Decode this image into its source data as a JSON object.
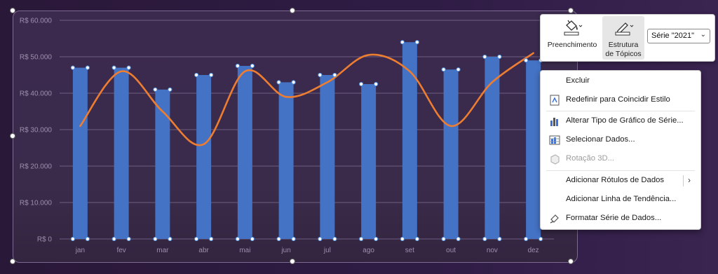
{
  "chart_data": {
    "type": "bar",
    "categories": [
      "jan",
      "fev",
      "mar",
      "abr",
      "mai",
      "jun",
      "jul",
      "ago",
      "set",
      "out",
      "nov",
      "dez"
    ],
    "series": [
      {
        "values": [
          47000,
          47000,
          41000,
          45000,
          47500,
          43000,
          45000,
          42500,
          54000,
          46500,
          50000,
          49000
        ],
        "color": "#4472c4"
      },
      {
        "type": "line",
        "smooth": true,
        "values": [
          31000,
          46000,
          35000,
          26000,
          46000,
          39000,
          43000,
          50500,
          46000,
          31000,
          43000,
          51000
        ],
        "color": "#ed7d31"
      }
    ],
    "yticks": [
      "R$ 0",
      "R$ 10.000",
      "R$ 20.000",
      "R$ 30.000",
      "R$ 40.000",
      "R$ 50.000",
      "R$ 60.000"
    ],
    "ylim": [
      0,
      60000
    ],
    "grid": true,
    "title": "",
    "xlabel": "",
    "ylabel": ""
  },
  "toolbar": {
    "fill_label": "Preenchimento",
    "outline_label_1": "Estrutura",
    "outline_label_2": "de Tópicos",
    "series_select_value": "Série \"2021\"",
    "fill_icon": "paint-bucket-icon",
    "outline_icon": "pen-outline-icon"
  },
  "menu": {
    "items": [
      {
        "label": "Excluir",
        "icon": "none",
        "enabled": true
      },
      {
        "label": "Redefinir para Coincidir Estilo",
        "icon": "reset-style-icon",
        "enabled": true
      },
      {
        "label": "Alterar Tipo de Gráfico de Série...",
        "icon": "change-chart-type-icon",
        "enabled": true
      },
      {
        "label": "Selecionar Dados...",
        "icon": "select-data-icon",
        "enabled": true
      },
      {
        "label": "Rotação 3D...",
        "icon": "rotation-3d-icon",
        "enabled": false
      },
      {
        "label": "Adicionar Rótulos de Dados",
        "icon": "none",
        "enabled": true,
        "submenu": true
      },
      {
        "label": "Adicionar Linha de Tendência...",
        "icon": "none",
        "enabled": true
      },
      {
        "label": "Formatar Série de Dados...",
        "icon": "format-series-icon",
        "enabled": true
      }
    ]
  },
  "colors": {
    "bar": "#4472c4",
    "line": "#ed7d31",
    "background": "#3a2a4c"
  }
}
